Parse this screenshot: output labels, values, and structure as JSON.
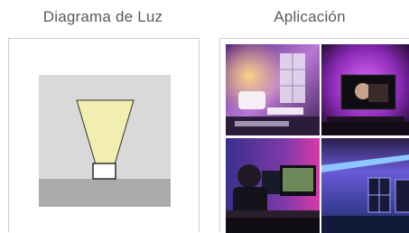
{
  "headings": {
    "light_diagram": "Diagrama de Luz",
    "application": "Aplicación"
  },
  "diagram": {
    "background_color": "#d9d9d9",
    "floor_color": "#a9abad",
    "beam_color": "#f2eeb0",
    "fixture_color": "#ffffff"
  },
  "photos": [
    {
      "icon": "living-room-photo",
      "accent": "#c07ad8"
    },
    {
      "icon": "tv-backlight-photo",
      "accent": "#b02ad8"
    },
    {
      "icon": "gaming-desk-photo",
      "accent": "#d83aa8"
    },
    {
      "icon": "wall-led-photo",
      "accent": "#3a6ee0"
    }
  ]
}
